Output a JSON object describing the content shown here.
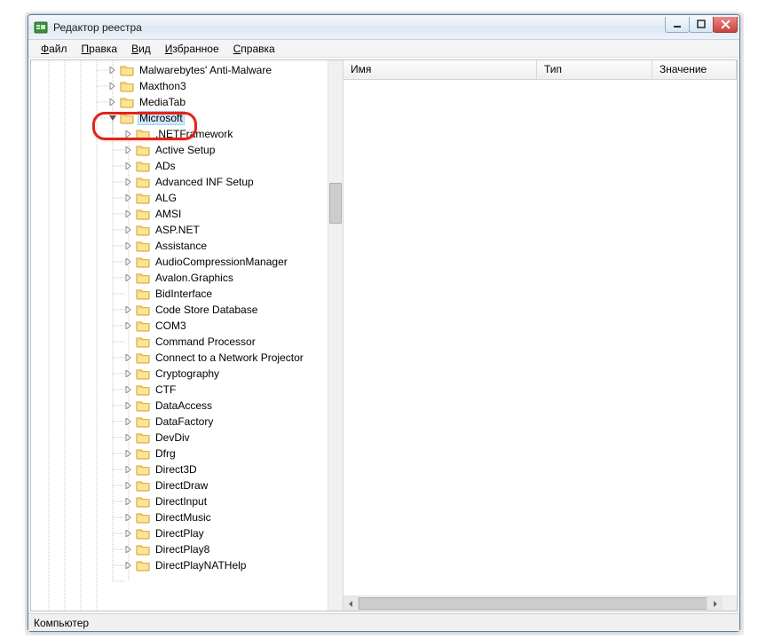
{
  "window": {
    "title": "Редактор реестра"
  },
  "menu": {
    "file": "айл",
    "file_u": "Ф",
    "edit": "равка",
    "edit_u": "П",
    "view": "ид",
    "view_u": "В",
    "fav": "збранное",
    "fav_u": "И",
    "help": "правка",
    "help_u": "С"
  },
  "columns": {
    "name": "Имя",
    "type": "Тип",
    "value": "Значение"
  },
  "statusbar": {
    "path": "Компьютер"
  },
  "tree": {
    "before": [
      {
        "label": "Malwarebytes' Anti-Malware",
        "depth": 4,
        "expander": "right"
      },
      {
        "label": "Maxthon3",
        "depth": 4,
        "expander": "right"
      },
      {
        "label": "MediaTab",
        "depth": 4,
        "expander": "right"
      }
    ],
    "selected": {
      "label": "Microsoft",
      "depth": 4,
      "expander": "down"
    },
    "children": [
      {
        "label": ".NETFramework",
        "expander": "right"
      },
      {
        "label": "Active Setup",
        "expander": "right"
      },
      {
        "label": "ADs",
        "expander": "right"
      },
      {
        "label": "Advanced INF Setup",
        "expander": "right"
      },
      {
        "label": "ALG",
        "expander": "right"
      },
      {
        "label": "AMSI",
        "expander": "right"
      },
      {
        "label": "ASP.NET",
        "expander": "right"
      },
      {
        "label": "Assistance",
        "expander": "right"
      },
      {
        "label": "AudioCompressionManager",
        "expander": "right"
      },
      {
        "label": "Avalon.Graphics",
        "expander": "right"
      },
      {
        "label": "BidInterface",
        "expander": "none"
      },
      {
        "label": "Code Store Database",
        "expander": "right"
      },
      {
        "label": "COM3",
        "expander": "right"
      },
      {
        "label": "Command Processor",
        "expander": "none"
      },
      {
        "label": "Connect to a Network Projector",
        "expander": "right"
      },
      {
        "label": "Cryptography",
        "expander": "right"
      },
      {
        "label": "CTF",
        "expander": "right"
      },
      {
        "label": "DataAccess",
        "expander": "right"
      },
      {
        "label": "DataFactory",
        "expander": "right"
      },
      {
        "label": "DevDiv",
        "expander": "right"
      },
      {
        "label": "Dfrg",
        "expander": "right"
      },
      {
        "label": "Direct3D",
        "expander": "right"
      },
      {
        "label": "DirectDraw",
        "expander": "right"
      },
      {
        "label": "DirectInput",
        "expander": "right"
      },
      {
        "label": "DirectMusic",
        "expander": "right"
      },
      {
        "label": "DirectPlay",
        "expander": "right"
      },
      {
        "label": "DirectPlay8",
        "expander": "right"
      },
      {
        "label": "DirectPlayNATHelp",
        "expander": "right"
      }
    ]
  }
}
